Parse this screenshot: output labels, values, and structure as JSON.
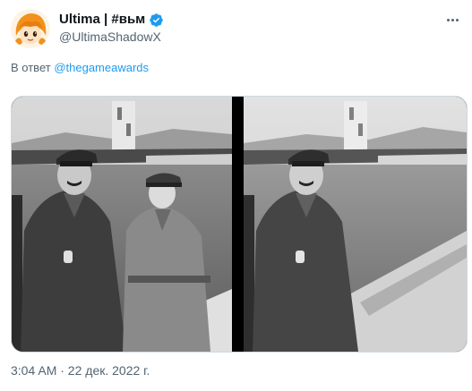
{
  "author": {
    "display_name": "Ultima | #вьм",
    "handle": "@UltimaShadowX",
    "avatar_icon": "anime-avatar-icon",
    "verified_icon": "verified-badge-icon"
  },
  "reply": {
    "prefix": "В ответ",
    "mention": "@thegameawards"
  },
  "media": {
    "photos": [
      {
        "name": "original-photo-with-two-men"
      },
      {
        "name": "edited-photo-with-one-man"
      }
    ]
  },
  "timestamp": "3:04 AM · 22 дек. 2022 г.",
  "colors": {
    "link": "#1d9bf0",
    "secondary_text": "#536471",
    "verified": "#1d9bf0"
  }
}
